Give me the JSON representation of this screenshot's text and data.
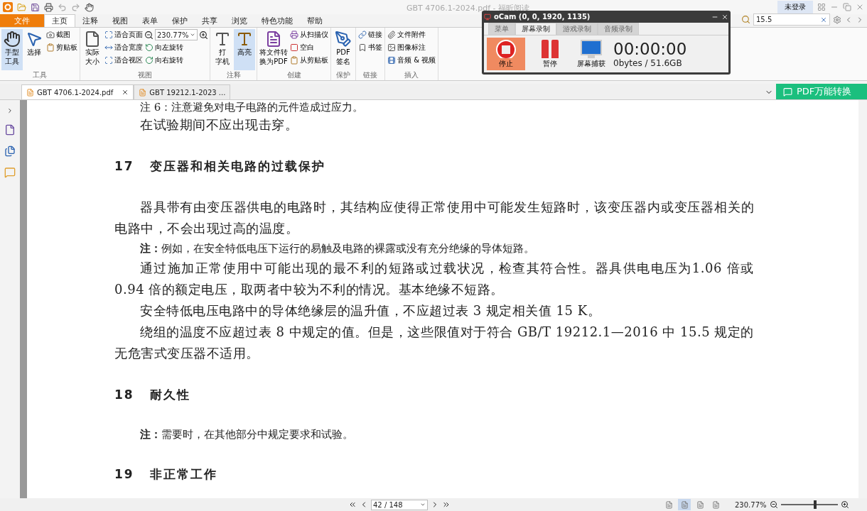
{
  "window": {
    "title": "GBT 4706.1-2024.pdf - 福昕阅读",
    "login": "未登录"
  },
  "menu_tabs": [
    {
      "label": "文件",
      "selected": false,
      "kind": "file"
    },
    {
      "label": "主页",
      "selected": true,
      "kind": "tab"
    },
    {
      "label": "注释",
      "selected": false,
      "kind": "tab"
    },
    {
      "label": "视图",
      "selected": false,
      "kind": "tab"
    },
    {
      "label": "表单",
      "selected": false,
      "kind": "tab"
    },
    {
      "label": "保护",
      "selected": false,
      "kind": "tab"
    },
    {
      "label": "共享",
      "selected": false,
      "kind": "tab"
    },
    {
      "label": "浏览",
      "selected": false,
      "kind": "tab"
    },
    {
      "label": "特色功能",
      "selected": false,
      "kind": "tab"
    },
    {
      "label": "帮助",
      "selected": false,
      "kind": "tab"
    }
  ],
  "search": {
    "value": "15.5"
  },
  "ribbon": [
    {
      "label": "工具",
      "items": [
        {
          "kind": "large",
          "lines": [
            "手型",
            "工具"
          ],
          "selected": true
        },
        {
          "kind": "large",
          "lines": [
            "选择"
          ],
          "selected": false
        },
        {
          "kind": "small",
          "label": "截图"
        },
        {
          "kind": "small",
          "label": "剪贴板"
        }
      ]
    },
    {
      "label": "视图",
      "items": [
        {
          "kind": "large",
          "lines": [
            "实际",
            "大小"
          ],
          "selected": false
        },
        {
          "kind": "small",
          "label": "适合页面"
        },
        {
          "kind": "small",
          "label": "适合宽度"
        },
        {
          "kind": "small",
          "label": "适合视区"
        },
        {
          "kind": "zoom",
          "label": "230.77%"
        },
        {
          "kind": "small",
          "label": "向左旋转"
        },
        {
          "kind": "small",
          "label": "向右旋转"
        }
      ]
    },
    {
      "label": "注释",
      "items": [
        {
          "kind": "large",
          "lines": [
            "打",
            "字机"
          ],
          "selected": false
        },
        {
          "kind": "large",
          "lines": [
            "高亮"
          ],
          "selected": true
        }
      ]
    },
    {
      "label": "创建",
      "items": [
        {
          "kind": "large",
          "lines": [
            "将文件转",
            "换为PDF"
          ],
          "selected": false
        },
        {
          "kind": "small",
          "label": "从扫描仪"
        },
        {
          "kind": "small",
          "label": "空白"
        },
        {
          "kind": "small",
          "label": "从剪贴板"
        }
      ]
    },
    {
      "label": "保护",
      "items": [
        {
          "kind": "large",
          "lines": [
            "PDF",
            "签名"
          ],
          "selected": false
        }
      ]
    },
    {
      "label": "链接",
      "items": [
        {
          "kind": "small",
          "label": "链接"
        },
        {
          "kind": "small",
          "label": "书签"
        }
      ]
    },
    {
      "label": "插入",
      "items": [
        {
          "kind": "small",
          "label": "文件附件"
        },
        {
          "kind": "small",
          "label": "图像标注"
        },
        {
          "kind": "small",
          "label": "音频 & 视频"
        }
      ]
    }
  ],
  "doc_tabs": [
    {
      "label": "GBT 4706.1-2024.pdf",
      "selected": true
    },
    {
      "label": "GBT 19212.1-2023 ...",
      "selected": false
    }
  ],
  "convert_button": "PDF万能转换",
  "document": [
    {
      "kind": "cut",
      "text": "注 6：注意避免对电子电路的元件造成过应力。"
    },
    {
      "kind": "para",
      "text": "在试验期间不应出现击穿。"
    },
    {
      "kind": "heading",
      "number": "17",
      "text": "变压器和相关电路的过载保护"
    },
    {
      "kind": "para",
      "text": "器具带有由变压器供电的电路时，其结构应使得正常使用中可能发生短路时，该变压器内或变压器相关的电路中，不会出现过高的温度。"
    },
    {
      "kind": "note",
      "text": "**注：**例如，在安全特低电压下运行的易触及电路的裸露或没有充分绝缘的导体短路。"
    },
    {
      "kind": "para",
      "text": "通过施加正常使用中可能出现的最不利的短路或过载状况，检查其符合性。器具供电电压为1.06 倍或 0.94 倍的额定电压，取两者中较为不利的情况。基本绝缘不短路。"
    },
    {
      "kind": "para",
      "text": "安全特低电压电路中的导体绝缘层的温升值，不应超过表 3 规定相关值 15 K。"
    },
    {
      "kind": "para",
      "text": "绕组的温度不应超过表 8 中规定的值。但是，这些限值对于符合 GB/T 19212.1—2016 中 15.5 规定的无危害式变压器不适用。"
    },
    {
      "kind": "heading",
      "number": "18",
      "text": "耐久性"
    },
    {
      "kind": "note",
      "text": "**注：**需要时，在其他部分中规定要求和试验。"
    },
    {
      "kind": "heading",
      "number": "19",
      "text": "非正常工作"
    }
  ],
  "status_bar": {
    "page": "42 / 148",
    "zoom": "230.77%",
    "zoom_slider": {
      "level": 0.6
    },
    "views": [
      {
        "selected": false
      },
      {
        "selected": true
      },
      {
        "selected": false
      },
      {
        "selected": false
      }
    ]
  },
  "ocam": {
    "title": "oCam (0, 0, 1920, 1135)",
    "tabs": [
      {
        "label": "菜单",
        "selected": false
      },
      {
        "label": "屏幕录制",
        "selected": true
      },
      {
        "label": "游戏录制",
        "selected": false
      },
      {
        "label": "音频录制",
        "selected": false
      }
    ],
    "buttons": [
      {
        "kind": "stop",
        "label": "停止"
      },
      {
        "kind": "pause",
        "label": "暂停"
      },
      {
        "kind": "capture",
        "label": "屏幕捕获"
      }
    ],
    "timer": "00:00:00",
    "size": "0bytes / 51.6GB"
  }
}
